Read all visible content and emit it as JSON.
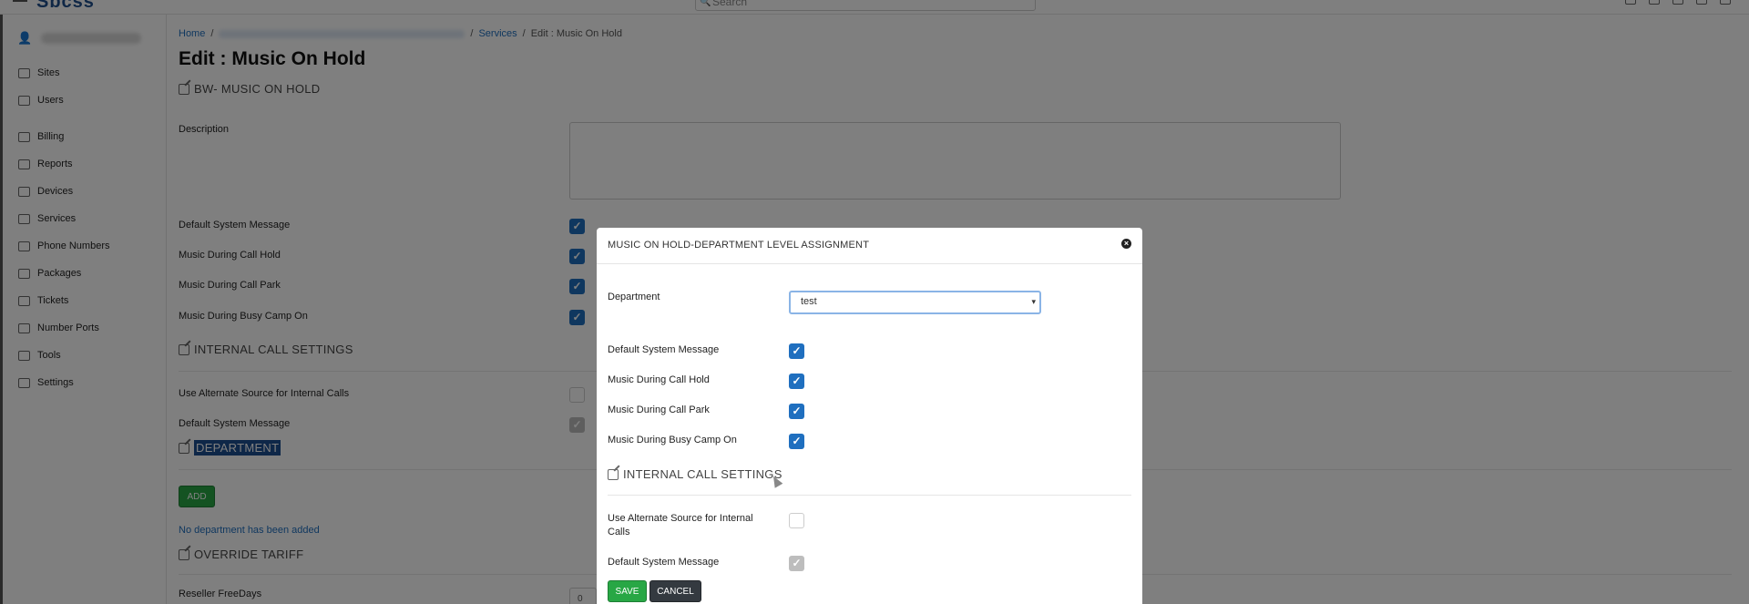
{
  "header": {
    "logo": "Sbcss",
    "search_placeholder": "Search",
    "icons": [
      "chat-icon",
      "doc-icon",
      "doc-icon",
      "gear-icon",
      "logout-icon"
    ]
  },
  "sidebar": {
    "items": [
      {
        "label": "Sites",
        "icon": "sites-icon"
      },
      {
        "label": "Users",
        "icon": "users-icon"
      },
      {
        "label": "Billing",
        "icon": "billing-icon"
      },
      {
        "label": "Reports",
        "icon": "reports-icon"
      },
      {
        "label": "Devices",
        "icon": "devices-icon"
      },
      {
        "label": "Services",
        "icon": "services-icon"
      },
      {
        "label": "Phone Numbers",
        "icon": "phone-icon"
      },
      {
        "label": "Packages",
        "icon": "packages-icon"
      },
      {
        "label": "Tickets",
        "icon": "tickets-icon"
      },
      {
        "label": "Number Ports",
        "icon": "number-ports-icon"
      },
      {
        "label": "Tools",
        "icon": "wrench-icon"
      },
      {
        "label": "Settings",
        "icon": "gear-icon"
      }
    ]
  },
  "breadcrumb": {
    "home": "Home",
    "sep": "/",
    "services": "Services",
    "current": "Edit : Music On Hold"
  },
  "page": {
    "title": "Edit : Music On Hold",
    "section_main": "BW- MUSIC ON HOLD",
    "description_label": "Description",
    "fields": [
      {
        "label": "Default System Message",
        "checked": true
      },
      {
        "label": "Music During Call Hold",
        "checked": true
      },
      {
        "label": "Music During Call Park",
        "checked": true
      },
      {
        "label": "Music During Busy Camp On",
        "checked": true
      }
    ],
    "section_internal": "INTERNAL CALL SETTINGS",
    "internal_fields": [
      {
        "label": "Use Alternate Source for Internal Calls",
        "checked": false
      },
      {
        "label": "Default System Message",
        "checked": true,
        "disabled": true
      }
    ],
    "section_department": "DEPARTMENT",
    "add_button": "ADD",
    "no_department": "No department has been added",
    "section_override": "OVERRIDE TARIFF",
    "reseller_freedays_label": "Reseller FreeDays",
    "reseller_freedays_value": "0"
  },
  "modal": {
    "title": "MUSIC ON HOLD-DEPARTMENT LEVEL ASSIGNMENT",
    "close": "×",
    "department_label": "Department",
    "department_value": "test",
    "fields": [
      {
        "label": "Default System Message",
        "checked": true
      },
      {
        "label": "Music During Call Hold",
        "checked": true
      },
      {
        "label": "Music During Call Park",
        "checked": true
      },
      {
        "label": "Music During Busy Camp On",
        "checked": true
      }
    ],
    "section_internal": "INTERNAL CALL SETTINGS",
    "internal_fields": [
      {
        "label": "Use Alternate Source for Internal Calls",
        "checked": false
      },
      {
        "label": "Default System Message",
        "checked": true,
        "disabled": true
      }
    ],
    "save": "SAVE",
    "cancel": "CANCEL"
  },
  "check_mark": "✓",
  "colors": {
    "primary": "#1f6fbf",
    "success": "#28a745",
    "dark": "#343a40",
    "highlight": "#1d4f91"
  }
}
